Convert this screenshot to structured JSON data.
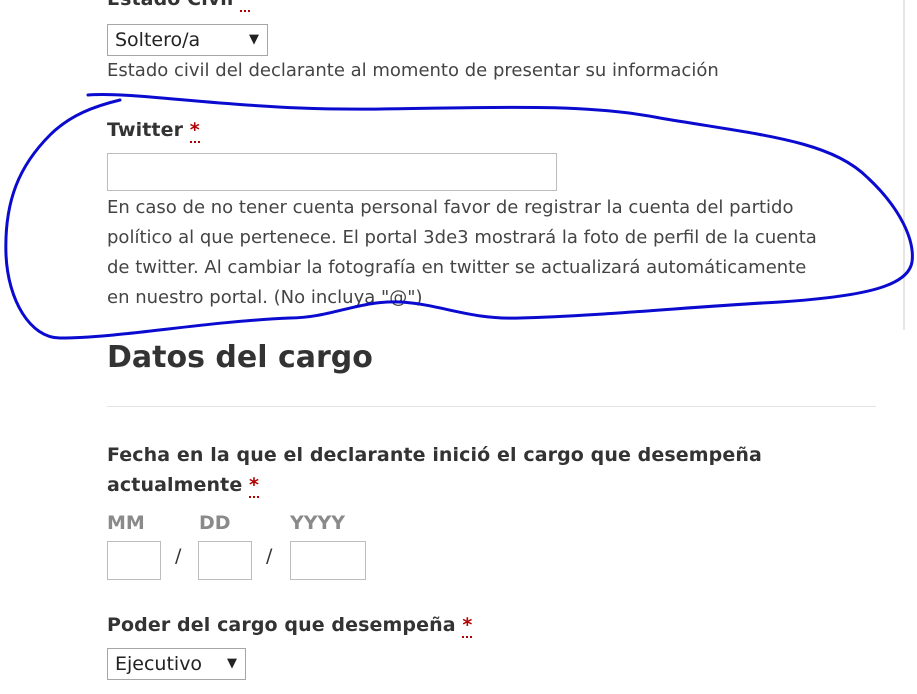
{
  "estado_civil": {
    "label": "Estado Civil",
    "required_mark": "*",
    "selected": "Soltero/a",
    "help": "Estado civil del declarante al momento de presentar su información"
  },
  "twitter": {
    "label": "Twitter",
    "required_mark": "*",
    "value": "",
    "help_line1": "En caso de no tener cuenta personal favor de registrar la cuenta del partido",
    "help_line2": "político al que pertenece. El portal 3de3 mostrará la foto de perfil de la cuenta",
    "help_line3": "de twitter. Al cambiar la fotografía en twitter se actualizará automáticamente",
    "help_line4": "en nuestro portal. (No incluya \"@\")"
  },
  "datos_cargo": {
    "title": "Datos del cargo"
  },
  "fecha_inicio": {
    "label_line1": "Fecha en la que el declarante inició el cargo que desempeña",
    "label_line2": "actualmente",
    "required_mark": "*",
    "month_label": "MM",
    "day_label": "DD",
    "year_label": "YYYY",
    "separator": "/",
    "month_value": "",
    "day_value": "",
    "year_value": ""
  },
  "poder_cargo": {
    "label": "Poder del cargo que desempeña",
    "required_mark": "*",
    "selected": "Ejecutivo"
  },
  "annotation": {
    "stroke_color": "#0b0bd0"
  },
  "icons": {
    "dropdown_arrow": "▼"
  }
}
